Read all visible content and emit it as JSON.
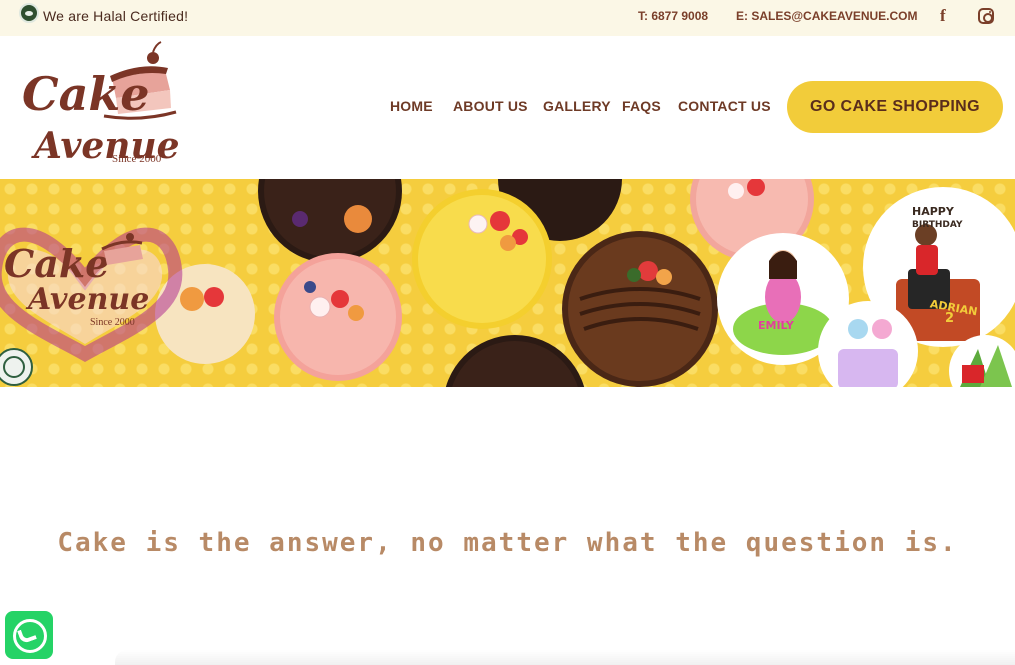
{
  "topbar": {
    "halal_text": "We are Halal Certified!",
    "phone": "T: 6877 9008",
    "email": "E: SALES@CAKEAVENUE.COM",
    "icons": [
      "halal-logo-icon",
      "facebook-icon",
      "instagram-icon"
    ]
  },
  "logo": {
    "line1": "Cake",
    "line2": "Avenue",
    "since": "Since 2000"
  },
  "nav": {
    "items": [
      "HOME",
      "ABOUT US",
      "GALLERY",
      "FAQS",
      "CONTACT US"
    ],
    "cta": "GO CAKE SHOPPING"
  },
  "banner": {
    "logo_line1": "Cake",
    "logo_line2": "Avenue",
    "logo_since": "Since 2000",
    "cake_name_1": "EMILY",
    "cake_name_2": "ADRIAN",
    "cake_number": "2"
  },
  "tagline": "Cake is the answer, no matter what the question is.",
  "colors": {
    "brand_brown": "#6e3a26",
    "accent_yellow": "#f2cc3a",
    "whatsapp_green": "#25d366",
    "tagline_tan": "#b88a66"
  }
}
